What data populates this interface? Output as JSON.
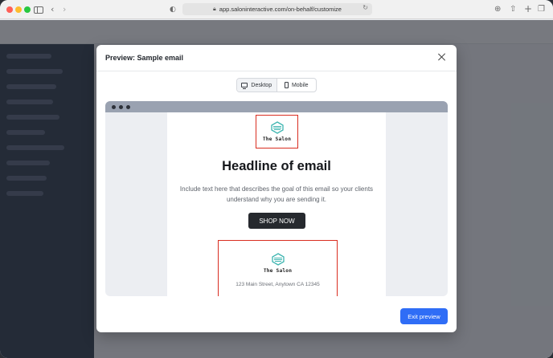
{
  "browser": {
    "url": "app.saloninteractive.com/on-behalf/customize",
    "icons": [
      "back-icon",
      "forward-icon",
      "sidebar-icon",
      "shield-icon",
      "lock-icon",
      "reload-icon",
      "download-icon",
      "share-icon",
      "new-tab-icon",
      "tabs-icon"
    ]
  },
  "modal": {
    "title": "Preview: Sample email",
    "view_toggle": {
      "desktop_label": "Desktop",
      "mobile_label": "Mobile",
      "selected": "Desktop"
    },
    "exit_label": "Exit preview"
  },
  "email": {
    "logo_text": "The Salon",
    "headline": "Headline of email",
    "body": "Include text here that describes the goal of this email so your clients understand why you are sending it.",
    "cta_label": "SHOP NOW",
    "footer_logo_text": "The Salon",
    "address": "123 Main Street, Anytown CA 12345"
  },
  "colors": {
    "primary": "#2f6df6",
    "highlight": "#d92d20",
    "cta": "#26292e",
    "logo_teal": "#3db5b0"
  }
}
